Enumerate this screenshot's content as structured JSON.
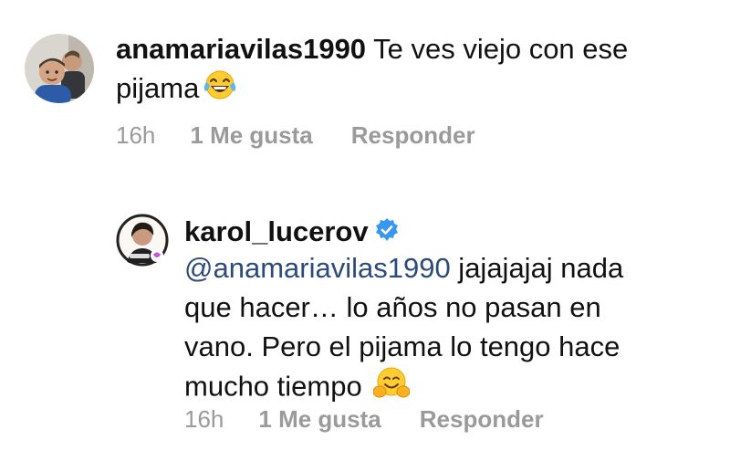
{
  "comments": [
    {
      "username": "anamariavilas1990",
      "text_before_emoji": " Te ves viejo con ese pijama",
      "emoji": "face-with-tears-of-joy",
      "time": "16h",
      "likes": "1 Me gusta",
      "reply": "Responder"
    },
    {
      "username": "karol_lucerov",
      "verified": true,
      "mention": "@anamariavilas1990",
      "text": " jajajajaj nada que hacer… lo años no pasan en vano. Pero el pijama lo tengo hace mucho tiempo",
      "emoji": "smiling-face-with-open-hands",
      "time": "16h",
      "likes": "1 Me gusta",
      "reply": "Responder"
    }
  ],
  "colors": {
    "text": "#111111",
    "meta": "#9a9a9a",
    "mention": "#2c4a7a",
    "verified": "#3897f0"
  }
}
